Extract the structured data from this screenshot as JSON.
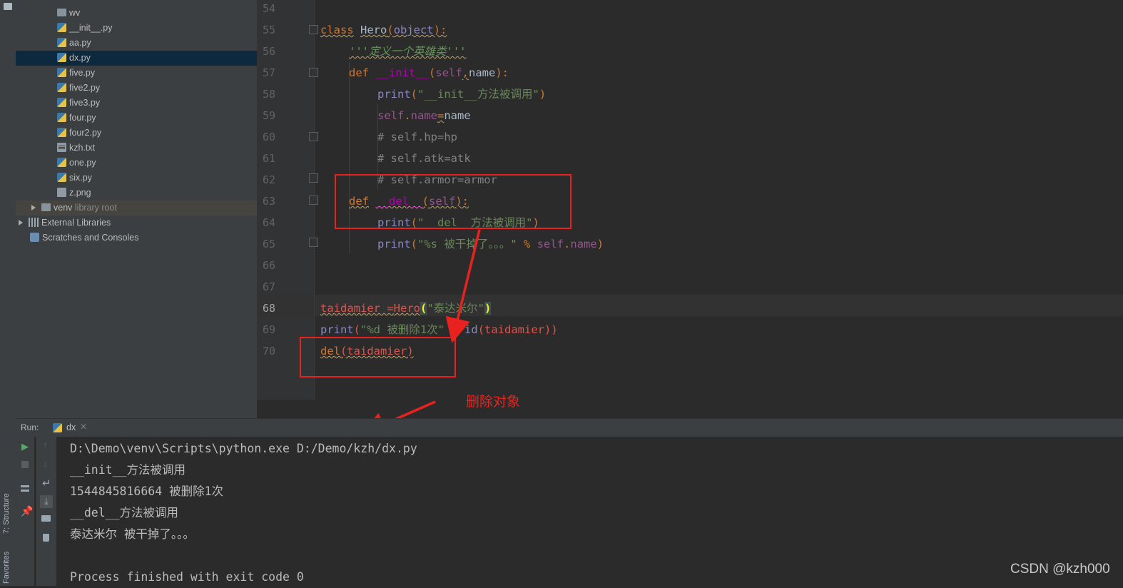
{
  "project_tree": {
    "items": [
      {
        "label": "wv",
        "type": "folder"
      },
      {
        "label": "__init__.py",
        "type": "py"
      },
      {
        "label": "aa.py",
        "type": "py"
      },
      {
        "label": "dx.py",
        "type": "py"
      },
      {
        "label": "five.py",
        "type": "py"
      },
      {
        "label": "five2.py",
        "type": "py"
      },
      {
        "label": "five3.py",
        "type": "py"
      },
      {
        "label": "four.py",
        "type": "py"
      },
      {
        "label": "four2.py",
        "type": "py"
      },
      {
        "label": "kzh.txt",
        "type": "txt"
      },
      {
        "label": "one.py",
        "type": "py"
      },
      {
        "label": "six.py",
        "type": "py"
      },
      {
        "label": "z.png",
        "type": "png"
      }
    ],
    "selected": "dx.py",
    "venv": {
      "label": "venv",
      "suffix": "library root"
    },
    "external": "External Libraries",
    "scratches": "Scratches and Consoles"
  },
  "side_tabs": {
    "structure": "7: Structure",
    "favorites": "Favorites"
  },
  "editor": {
    "line_numbers": [
      "54",
      "55",
      "56",
      "57",
      "58",
      "59",
      "60",
      "61",
      "62",
      "63",
      "64",
      "65",
      "66",
      "67",
      "68",
      "69",
      "70"
    ],
    "current_line": "68",
    "code": {
      "l55": {
        "kw": "class",
        "name": "Hero",
        "paren_open": "(",
        "base": "object",
        "tail": "):"
      },
      "l56": {
        "doc": "'''定义一个英雄类'''"
      },
      "l57": {
        "kw": "def",
        "fn": "__init__",
        "open": "(",
        "self": "self",
        "sep": ",",
        "arg": "name",
        "close": "):"
      },
      "l58": {
        "fn": "print",
        "open": "(",
        "str": "\"__init__方法被调用\"",
        "close": ")"
      },
      "l59": {
        "self": "self",
        "dot": ".",
        "attr": "name",
        "eq": "=",
        "val": "name"
      },
      "l60": {
        "comment": "# self.hp=hp"
      },
      "l61": {
        "comment": "# self.atk=atk"
      },
      "l62": {
        "comment": "# self.armor=armor"
      },
      "l63": {
        "kw": "def",
        "fn": "__del__",
        "open": "(",
        "self": "self",
        "close": "):"
      },
      "l64": {
        "fn": "print",
        "open": "(",
        "str": "\"__del__方法被调用\"",
        "close": ")"
      },
      "l65": {
        "fn": "print",
        "open": "(",
        "str": "\"%s 被干掉了。。。\"",
        "op": " % ",
        "self": "self",
        "dot": ".",
        "attr": "name",
        "close": ")"
      },
      "l68": {
        "var": "taidamier",
        "eq": " =",
        "cls": "Hero",
        "open": "(",
        "str": "\"泰达米尔\"",
        "close": ")"
      },
      "l69": {
        "fn": "print",
        "open": "(",
        "str": "\"%d 被删除1次\"",
        "op": " % ",
        "bi": "id",
        "arg": "(taidamier)",
        "close": ")"
      },
      "l70": {
        "kw": "del",
        "arg": "(taidamier)"
      }
    }
  },
  "annotation": {
    "label": "删除对象"
  },
  "run_panel": {
    "run_label": "Run:",
    "tab_label": "dx",
    "output": [
      "D:\\Demo\\venv\\Scripts\\python.exe D:/Demo/kzh/dx.py",
      "__init__方法被调用",
      "1544845816664 被删除1次",
      "__del__方法被调用",
      "泰达米尔 被干掉了。。。",
      "",
      "Process finished with exit code 0"
    ]
  },
  "watermark": "CSDN @kzh000",
  "colors": {
    "accent_red": "#e8231f",
    "selection": "#0d293e",
    "background": "#2b2b2b"
  }
}
